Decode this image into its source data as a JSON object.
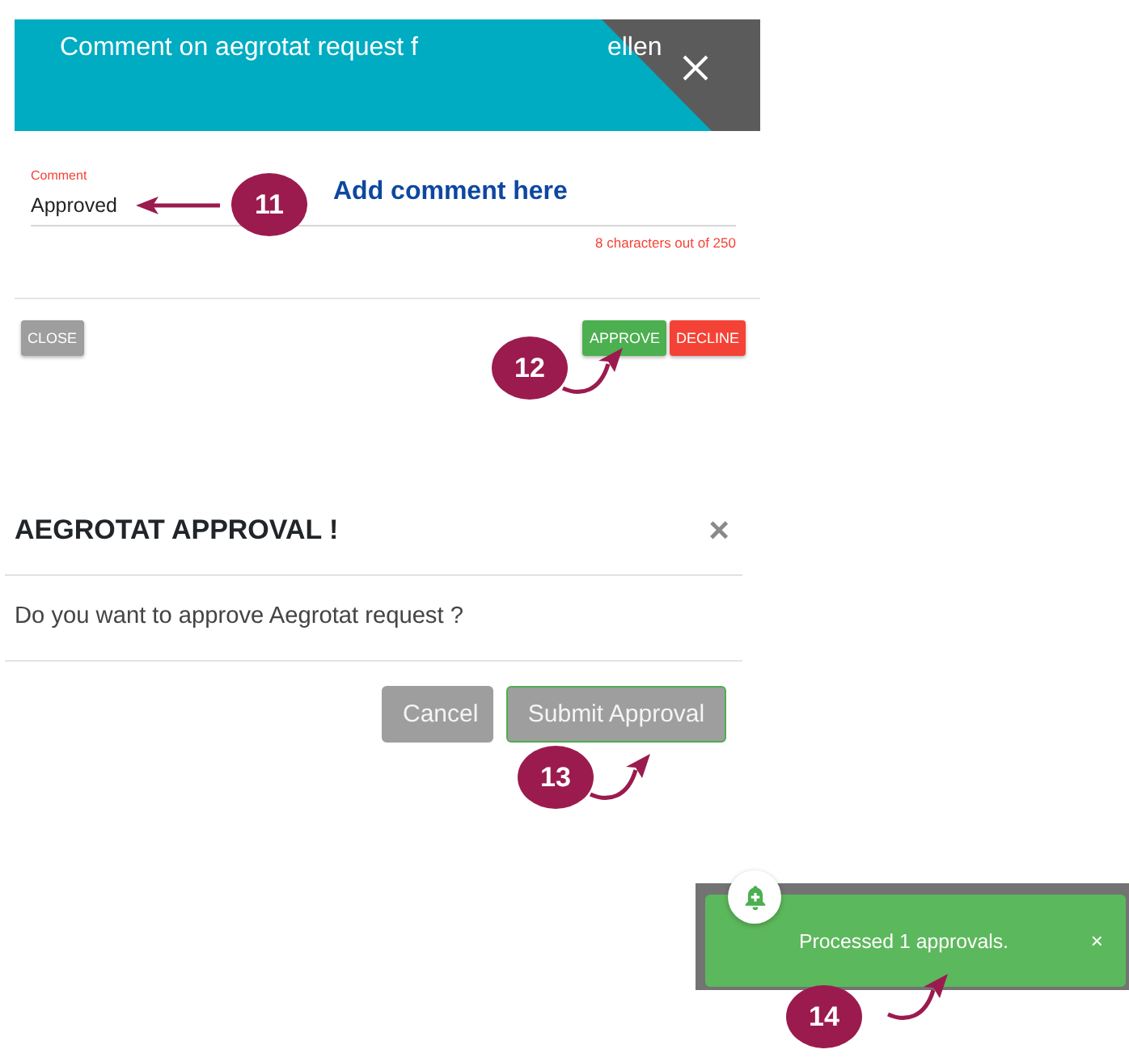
{
  "comment_dialog": {
    "title_start": "Comment on aegrotat request f",
    "title_end": "ellen",
    "comment_field": {
      "label": "Comment",
      "value": "Approved",
      "counter": "8 characters out of 250"
    },
    "buttons": [
      {
        "label": "CLOSE",
        "kind": "neutral"
      },
      {
        "label": "APPROVE",
        "kind": "approve"
      },
      {
        "label": "DECLINE",
        "kind": "decline"
      }
    ]
  },
  "approval_dialog": {
    "title": "AEGROTAT APPROVAL !",
    "close": "×",
    "message": "Do you want to approve Aegrotat request ?",
    "buttons": [
      {
        "label": "Cancel",
        "kind": "cancel"
      },
      {
        "label": "Submit Approval",
        "kind": "submit"
      }
    ]
  },
  "toast": {
    "message": "Processed 1 approvals.",
    "close": "×"
  },
  "callouts": [
    {
      "number": "11",
      "kind": "straight",
      "note": "Add comment here"
    },
    {
      "number": "12",
      "kind": "curved"
    },
    {
      "number": "13",
      "kind": "curved"
    },
    {
      "number": "14",
      "kind": "curved"
    }
  ]
}
